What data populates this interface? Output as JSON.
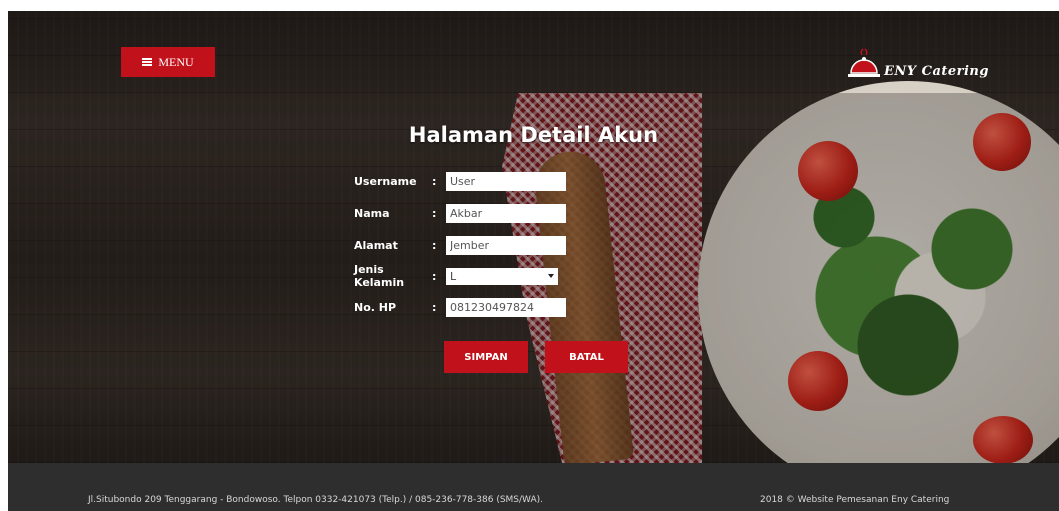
{
  "header": {
    "menu_label": "MENU",
    "logo_text": "ENY Catering"
  },
  "page_title": "Halaman Detail Akun",
  "form": {
    "fields": [
      {
        "label": "Username",
        "colon": ":",
        "value": "User"
      },
      {
        "label": "Nama",
        "colon": ":",
        "value": "Akbar"
      },
      {
        "label": "Alamat",
        "colon": ":",
        "value": "Jember"
      },
      {
        "label": "Jenis Kelamin",
        "colon": ":",
        "value": "L"
      },
      {
        "label": "No. HP",
        "colon": ":",
        "value": "081230497824"
      }
    ],
    "save_label": "SIMPAN",
    "cancel_label": "BATAL"
  },
  "footer": {
    "address": "Jl.Situbondo 209 Tenggarang - Bondowoso. Telpon 0332-421073 (Telp.) / 085-236-778-386 (SMS/WA).",
    "copyright": "2018 © Website Pemesanan Eny Catering"
  },
  "colors": {
    "accent": "#c1121b",
    "footer_bg": "#2e2e2e"
  }
}
